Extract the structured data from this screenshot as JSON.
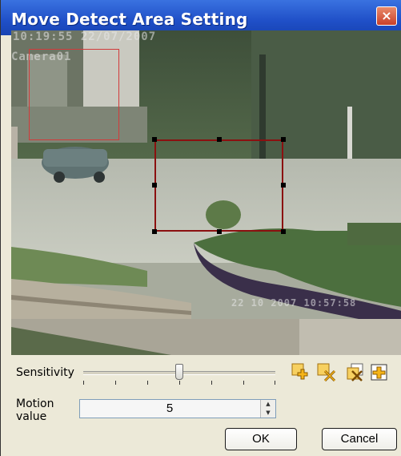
{
  "window": {
    "title": "Move Detect Area Setting",
    "close_glyph": "×"
  },
  "camera": {
    "osd_time": "10:19:55 22/07/2007",
    "osd_name": "Camera01",
    "osd_bottom": "22 10 2007 10:57:58"
  },
  "controls": {
    "sensitivity_label": "Sensitivity",
    "sensitivity_level": 0.5,
    "tools": [
      {
        "name": "add-area-icon"
      },
      {
        "name": "delete-area-icon"
      },
      {
        "name": "clear-all-icon"
      },
      {
        "name": "full-area-icon"
      }
    ],
    "motion_label_line1": "Motion",
    "motion_label_line2": "value",
    "motion_value": "5",
    "ok_label": "OK",
    "cancel_label": "Cancel"
  },
  "colors": {
    "titlebar": "#1f4fc7",
    "selection_active": "#8b1010",
    "selection_inactive": "#d23a3a"
  }
}
